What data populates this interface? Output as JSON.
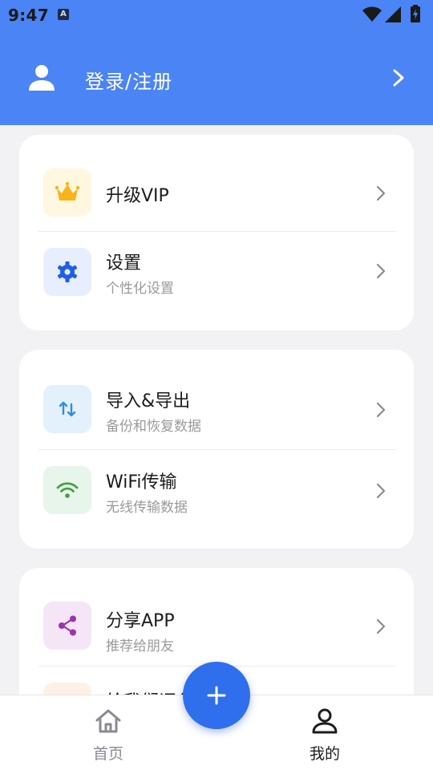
{
  "status_bar": {
    "time": "9:47",
    "notification_glyph": "A",
    "icons": [
      "wifi-icon",
      "signal-icon",
      "battery-icon"
    ]
  },
  "header": {
    "login_label": "登录/注册",
    "icons": [
      "user-avatar-icon",
      "chevron-right-icon"
    ]
  },
  "sections": [
    {
      "items": [
        {
          "title": "升级VIP",
          "subtitle": "",
          "icon": "crown-icon",
          "icon_bg": "#fff7e0",
          "icon_color": "#f6b41a"
        },
        {
          "title": "设置",
          "subtitle": "个性化设置",
          "icon": "gear-icon",
          "icon_bg": "#e7eefe",
          "icon_color": "#1f5fe6"
        }
      ]
    },
    {
      "items": [
        {
          "title": "导入&导出",
          "subtitle": "备份和恢复数据",
          "icon": "swap-vertical-icon",
          "icon_bg": "#e3f1fd",
          "icon_color": "#2d8fe0"
        },
        {
          "title": "WiFi传输",
          "subtitle": "无线传输数据",
          "icon": "wifi-icon",
          "icon_bg": "#e8f5ea",
          "icon_color": "#43a047"
        }
      ]
    },
    {
      "items": [
        {
          "title": "分享APP",
          "subtitle": "推荐给朋友",
          "icon": "share-icon",
          "icon_bg": "#f4e6f7",
          "icon_color": "#9c32b0"
        },
        {
          "title": "给我们评分",
          "subtitle": "",
          "icon": "star-icon",
          "icon_bg": "#fdf1e3",
          "icon_color": "#f0a040"
        }
      ]
    }
  ],
  "bottom_nav": {
    "items": [
      {
        "label": "首页",
        "icon": "home-icon",
        "active": false
      },
      {
        "label": "我的",
        "icon": "person-icon",
        "active": true
      }
    ],
    "fab_icon": "plus-icon"
  },
  "colors": {
    "header_bg": "#4a84f5",
    "fab_bg": "#2f6fed",
    "page_bg": "#f2f2f4"
  }
}
